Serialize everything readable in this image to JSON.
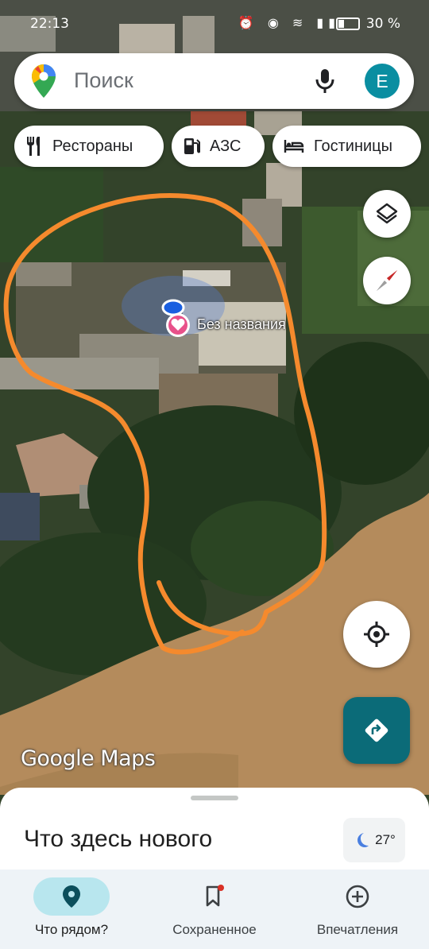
{
  "status_bar": {
    "time": "22:13",
    "battery": "30 %",
    "battery_level": 0.3
  },
  "search": {
    "placeholder": "Поиск",
    "avatar_letter": "E"
  },
  "chips": [
    {
      "label": "Рестораны",
      "icon": "fork-knife-icon"
    },
    {
      "label": "АЗС",
      "icon": "gas-station-icon"
    },
    {
      "label": "Гостиницы",
      "icon": "bed-icon"
    }
  ],
  "map": {
    "poi_label": "Без названия",
    "watermark": "Google Maps",
    "annotation_color": "#f58a2d",
    "accent": "#0b6b78"
  },
  "sheet": {
    "title": "Что здесь нового",
    "temperature": "27°"
  },
  "bottom_nav": [
    {
      "label": "Что рядом?",
      "icon": "location-pin-icon",
      "active": true
    },
    {
      "label": "Сохраненное",
      "icon": "bookmark-icon",
      "active": false
    },
    {
      "label": "Впечатления",
      "icon": "plus-circle-icon",
      "active": false
    }
  ]
}
